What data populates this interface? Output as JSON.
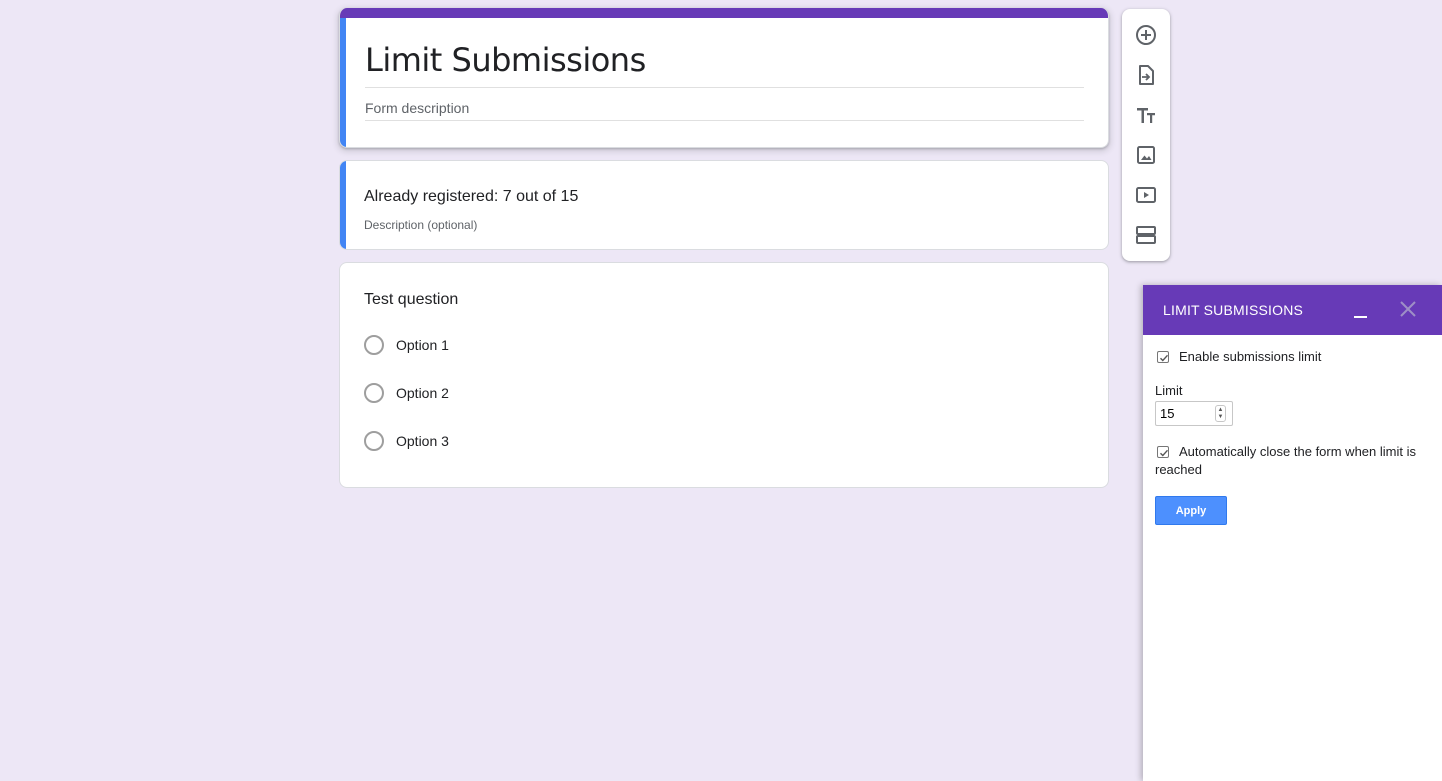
{
  "form": {
    "title": "Limit Submissions",
    "description_placeholder": "Form description"
  },
  "section": {
    "title": "Already registered: 7 out of 15",
    "description_placeholder": "Description (optional)"
  },
  "question": {
    "title": "Test question",
    "options": [
      "Option 1",
      "Option 2",
      "Option 3"
    ]
  },
  "toolbar": {
    "items": [
      "add-question-icon",
      "import-questions-icon",
      "add-title-icon",
      "add-image-icon",
      "add-video-icon",
      "add-section-icon"
    ]
  },
  "panel": {
    "title": "LIMIT SUBMISSIONS",
    "enable_label": "Enable submissions limit",
    "enable_checked": true,
    "limit_label": "Limit",
    "limit_value": "15",
    "autoclose_label": "Automatically close the form when limit is reached",
    "autoclose_checked": true,
    "apply_label": "Apply"
  },
  "colors": {
    "theme": "#673ab7",
    "accent": "#4285f4",
    "background": "#ede7f6",
    "apply_button": "#4d90fe"
  }
}
